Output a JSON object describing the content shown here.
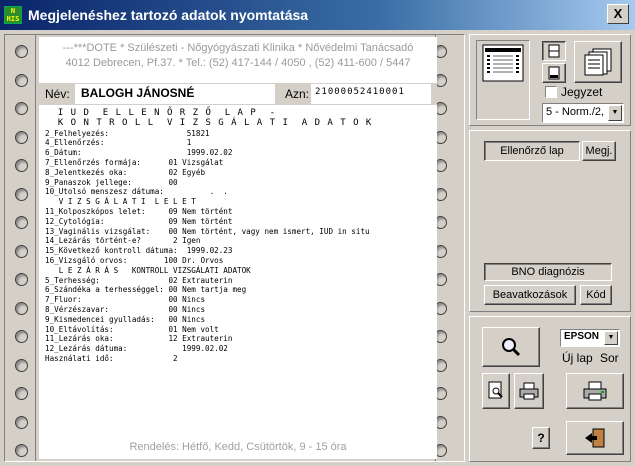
{
  "window": {
    "title": "Megjelenéshez tartozó adatok nyomtatása",
    "close_label": "X",
    "app_icon_text": "N HIS"
  },
  "paper": {
    "clinic_line1": "---***DOTE * Szülészeti - Nőgyógyászati Klinika * Nővédelmi Tanácsadó",
    "clinic_line2": "4012 Debrecen, Pf.37. * Tel.: (52) 417-144 / 4050 , (52) 411-600 / 5447",
    "name_label": "Név:",
    "name_value": "BALOGH JÁNOSNÉ",
    "azn_label": "Azn:",
    "azn_value": "21000052410001",
    "footer": "Rendelés: Hétfő, Kedd, Csütörtök, 9 - 15 óra"
  },
  "report_lines": [
    "  I U D  E L L E N Ő R Z Ő  L A P  -",
    "  K O N T R O L L  V I Z S G Á L A T I  A D A T O K",
    "2_Felhelyezés:                 51821",
    "4_Ellenőrzés:                  1",
    "6_Dátum:                       1999.02.02",
    "7_Ellenőrzés formája:      01 Vizsgálat",
    "8_Jelentkezés oka:         02 Egyéb",
    "9_Panaszok jellege:        00",
    "10_Utolsó menszesz dátuma:          .  .",
    "   V I Z S G Á L A T I  L E L E T",
    "11_Kolposzkópos lelet:     09 Nem történt",
    "12_Cytológia:              09 Nem történt",
    "13_Vaginális vizsgálat:    00 Nem történt, vagy nem ismert, IUD in situ",
    "14_Lezárás történt-e?       2 Igen",
    "15_Következő kontroll dátuma:  1999.02.23",
    "16_Vizsgáló orvos:        100 Dr. Orvos",
    "   L E Z Á R Á S   KONTROLL VIZSGÁLATI ADATOK",
    "5_Terhesség:               02 Extrauterin",
    "6_Szándéka a terhességgel: 00 Nem tartja meg",
    "7_Fluor:                   00 Nincs",
    "8_Vérzészavar:             00 Nincs",
    "9_Kismedencei gyulladás:   00 Nincs",
    "10_Eltávolítás:            01 Nem volt",
    "11_Lezárás oka:            12 Extrauterin",
    "12_Lezárás dátuma:            1999.02.02",
    "Használati idő:             2"
  ],
  "right_panel": {
    "jegyzet_label": "Jegyzet",
    "jegyzet_checked": false,
    "format_select": "5 - Norm./2,",
    "tabs": [
      "Ellenőrző lap",
      "Megj."
    ],
    "bno_label": "BNO diagnózis",
    "beavatkozasok_label": "Beavatkozások",
    "kod_label": "Kód",
    "printer_select": "EPSON",
    "uj_lap_label": "Új lap",
    "sor_label": "Sor",
    "help_label": "?"
  }
}
